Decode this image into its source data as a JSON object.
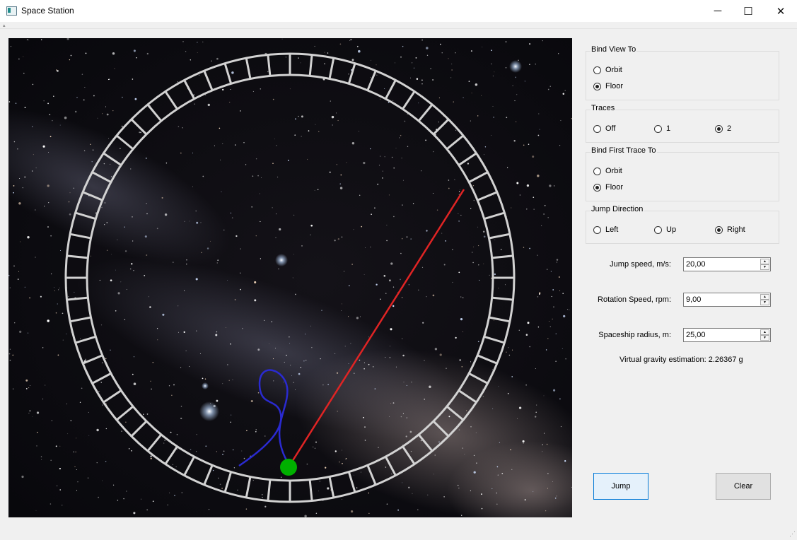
{
  "window": {
    "title": "Space Station",
    "minimize_glyph": "─",
    "maximize_glyph": "☐",
    "close_glyph": "✕"
  },
  "icons": {
    "app": "app-window-icon",
    "minimize": "minimize-icon",
    "maximize": "maximize-icon",
    "close": "close-icon"
  },
  "groups": {
    "bind_view": {
      "label": "Bind View To",
      "options": [
        "Orbit",
        "Floor"
      ],
      "selected": "Floor"
    },
    "traces": {
      "label": "Traces",
      "options": [
        "Off",
        "1",
        "2"
      ],
      "selected": "2"
    },
    "bind_trace": {
      "label": "Bind First Trace To",
      "options": [
        "Orbit",
        "Floor"
      ],
      "selected": "Floor"
    },
    "jump_dir": {
      "label": "Jump Direction",
      "options": [
        "Left",
        "Up",
        "Right"
      ],
      "selected": "Right"
    }
  },
  "fields": {
    "jump_speed": {
      "label": "Jump speed, m/s:",
      "value": "20,00"
    },
    "rotation_speed": {
      "label": "Rotation Speed, rpm:",
      "value": "9,00"
    },
    "radius": {
      "label": "Spaceship radius, m:",
      "value": "25,00"
    }
  },
  "estimate": "Virtual gravity estimation: 2.26367 g",
  "buttons": {
    "jump": "Jump",
    "clear": "Clear"
  },
  "colors": {
    "ring": "#d2d2d2",
    "red_trace": "#e02424",
    "blue_trace": "#2a2ad0",
    "astronaut": "#00b000",
    "focus_border": "#0078d7"
  }
}
